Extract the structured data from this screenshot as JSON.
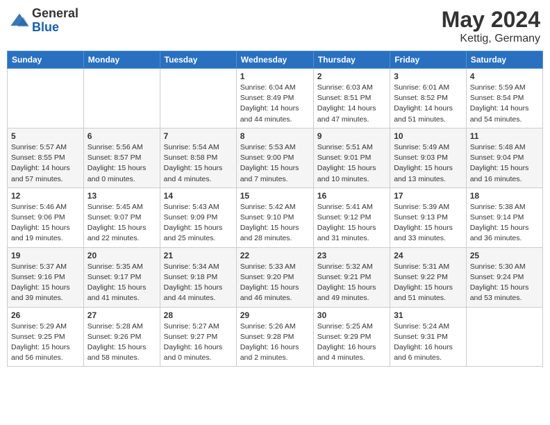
{
  "header": {
    "logo_general": "General",
    "logo_blue": "Blue",
    "month_year": "May 2024",
    "location": "Kettig, Germany"
  },
  "days_of_week": [
    "Sunday",
    "Monday",
    "Tuesday",
    "Wednesday",
    "Thursday",
    "Friday",
    "Saturday"
  ],
  "weeks": [
    [
      {
        "day": "",
        "info": ""
      },
      {
        "day": "",
        "info": ""
      },
      {
        "day": "",
        "info": ""
      },
      {
        "day": "1",
        "info": "Sunrise: 6:04 AM\nSunset: 8:49 PM\nDaylight: 14 hours\nand 44 minutes."
      },
      {
        "day": "2",
        "info": "Sunrise: 6:03 AM\nSunset: 8:51 PM\nDaylight: 14 hours\nand 47 minutes."
      },
      {
        "day": "3",
        "info": "Sunrise: 6:01 AM\nSunset: 8:52 PM\nDaylight: 14 hours\nand 51 minutes."
      },
      {
        "day": "4",
        "info": "Sunrise: 5:59 AM\nSunset: 8:54 PM\nDaylight: 14 hours\nand 54 minutes."
      }
    ],
    [
      {
        "day": "5",
        "info": "Sunrise: 5:57 AM\nSunset: 8:55 PM\nDaylight: 14 hours\nand 57 minutes."
      },
      {
        "day": "6",
        "info": "Sunrise: 5:56 AM\nSunset: 8:57 PM\nDaylight: 15 hours\nand 0 minutes."
      },
      {
        "day": "7",
        "info": "Sunrise: 5:54 AM\nSunset: 8:58 PM\nDaylight: 15 hours\nand 4 minutes."
      },
      {
        "day": "8",
        "info": "Sunrise: 5:53 AM\nSunset: 9:00 PM\nDaylight: 15 hours\nand 7 minutes."
      },
      {
        "day": "9",
        "info": "Sunrise: 5:51 AM\nSunset: 9:01 PM\nDaylight: 15 hours\nand 10 minutes."
      },
      {
        "day": "10",
        "info": "Sunrise: 5:49 AM\nSunset: 9:03 PM\nDaylight: 15 hours\nand 13 minutes."
      },
      {
        "day": "11",
        "info": "Sunrise: 5:48 AM\nSunset: 9:04 PM\nDaylight: 15 hours\nand 16 minutes."
      }
    ],
    [
      {
        "day": "12",
        "info": "Sunrise: 5:46 AM\nSunset: 9:06 PM\nDaylight: 15 hours\nand 19 minutes."
      },
      {
        "day": "13",
        "info": "Sunrise: 5:45 AM\nSunset: 9:07 PM\nDaylight: 15 hours\nand 22 minutes."
      },
      {
        "day": "14",
        "info": "Sunrise: 5:43 AM\nSunset: 9:09 PM\nDaylight: 15 hours\nand 25 minutes."
      },
      {
        "day": "15",
        "info": "Sunrise: 5:42 AM\nSunset: 9:10 PM\nDaylight: 15 hours\nand 28 minutes."
      },
      {
        "day": "16",
        "info": "Sunrise: 5:41 AM\nSunset: 9:12 PM\nDaylight: 15 hours\nand 31 minutes."
      },
      {
        "day": "17",
        "info": "Sunrise: 5:39 AM\nSunset: 9:13 PM\nDaylight: 15 hours\nand 33 minutes."
      },
      {
        "day": "18",
        "info": "Sunrise: 5:38 AM\nSunset: 9:14 PM\nDaylight: 15 hours\nand 36 minutes."
      }
    ],
    [
      {
        "day": "19",
        "info": "Sunrise: 5:37 AM\nSunset: 9:16 PM\nDaylight: 15 hours\nand 39 minutes."
      },
      {
        "day": "20",
        "info": "Sunrise: 5:35 AM\nSunset: 9:17 PM\nDaylight: 15 hours\nand 41 minutes."
      },
      {
        "day": "21",
        "info": "Sunrise: 5:34 AM\nSunset: 9:18 PM\nDaylight: 15 hours\nand 44 minutes."
      },
      {
        "day": "22",
        "info": "Sunrise: 5:33 AM\nSunset: 9:20 PM\nDaylight: 15 hours\nand 46 minutes."
      },
      {
        "day": "23",
        "info": "Sunrise: 5:32 AM\nSunset: 9:21 PM\nDaylight: 15 hours\nand 49 minutes."
      },
      {
        "day": "24",
        "info": "Sunrise: 5:31 AM\nSunset: 9:22 PM\nDaylight: 15 hours\nand 51 minutes."
      },
      {
        "day": "25",
        "info": "Sunrise: 5:30 AM\nSunset: 9:24 PM\nDaylight: 15 hours\nand 53 minutes."
      }
    ],
    [
      {
        "day": "26",
        "info": "Sunrise: 5:29 AM\nSunset: 9:25 PM\nDaylight: 15 hours\nand 56 minutes."
      },
      {
        "day": "27",
        "info": "Sunrise: 5:28 AM\nSunset: 9:26 PM\nDaylight: 15 hours\nand 58 minutes."
      },
      {
        "day": "28",
        "info": "Sunrise: 5:27 AM\nSunset: 9:27 PM\nDaylight: 16 hours\nand 0 minutes."
      },
      {
        "day": "29",
        "info": "Sunrise: 5:26 AM\nSunset: 9:28 PM\nDaylight: 16 hours\nand 2 minutes."
      },
      {
        "day": "30",
        "info": "Sunrise: 5:25 AM\nSunset: 9:29 PM\nDaylight: 16 hours\nand 4 minutes."
      },
      {
        "day": "31",
        "info": "Sunrise: 5:24 AM\nSunset: 9:31 PM\nDaylight: 16 hours\nand 6 minutes."
      },
      {
        "day": "",
        "info": ""
      }
    ]
  ]
}
